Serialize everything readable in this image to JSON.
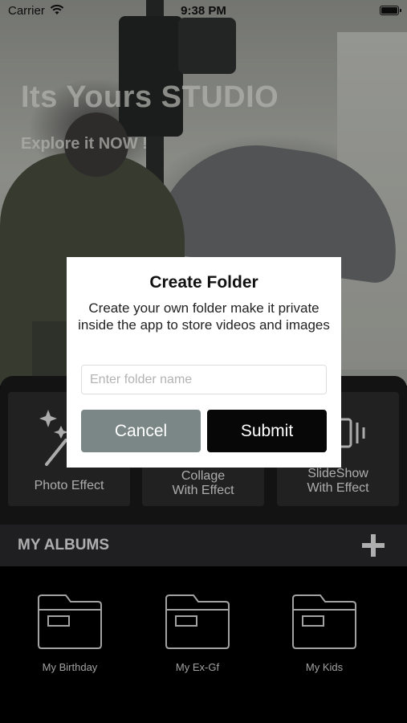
{
  "status_bar": {
    "carrier": "Carrier",
    "time": "9:38 PM"
  },
  "hero": {
    "title": "Its Yours STUDIO",
    "subtitle": "Explore it NOW !"
  },
  "features": [
    {
      "line1": "Photo Effect",
      "line2": ""
    },
    {
      "line1": "Collage",
      "line2": "With Effect"
    },
    {
      "line1": "SlideShow",
      "line2": "With Effect"
    }
  ],
  "albums": {
    "title": "MY ALBUMS",
    "items": [
      {
        "name": "My Birthday"
      },
      {
        "name": "My Ex-Gf"
      },
      {
        "name": "My Kids"
      }
    ]
  },
  "dialog": {
    "title": "Create Folder",
    "message": "Create your own folder make it private inside the app to store videos and images",
    "input_placeholder": "Enter folder name",
    "input_value": "",
    "cancel_label": "Cancel",
    "submit_label": "Submit"
  },
  "colors": {
    "cancel_button": "#7b8786",
    "submit_button": "#070707",
    "panel": "#1a1a1b"
  }
}
